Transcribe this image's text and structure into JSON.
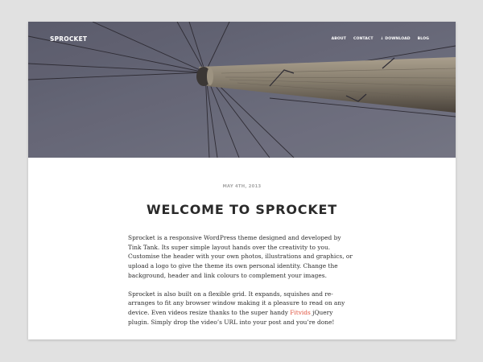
{
  "header": {
    "site_title": "Sprocket",
    "nav": [
      {
        "label": "About"
      },
      {
        "label": "Contact"
      },
      {
        "label": "↓ Download"
      },
      {
        "label": "Blog"
      }
    ]
  },
  "post": {
    "date": "May 4th, 2013",
    "title": "Welcome to Sprocket",
    "paragraph1": "Sprocket is a responsive WordPress theme designed and developed by Tink Tank. Its super simple layout hands over the creativity to you. Customise the header with your own photos, illustrations and graphics, or upload a logo to give the theme its own personal identity. Change the background, header and link colours to complement your images.",
    "paragraph2_before": "Sprocket is also built on a flexible grid. It expands, squishes and re-arranges to fit any browser window making it a pleasure to read on any device. Even videos resize thanks to the super handy ",
    "paragraph2_link": "Fitvids",
    "paragraph2_after": " jQuery plugin. Simply drop the video’s URL into your post and you’re done!"
  },
  "colors": {
    "page_background": "#e1e1e1",
    "link_accent": "#e0533f",
    "title_text": "#2a2a2a",
    "date_text": "#a6a6a6"
  }
}
